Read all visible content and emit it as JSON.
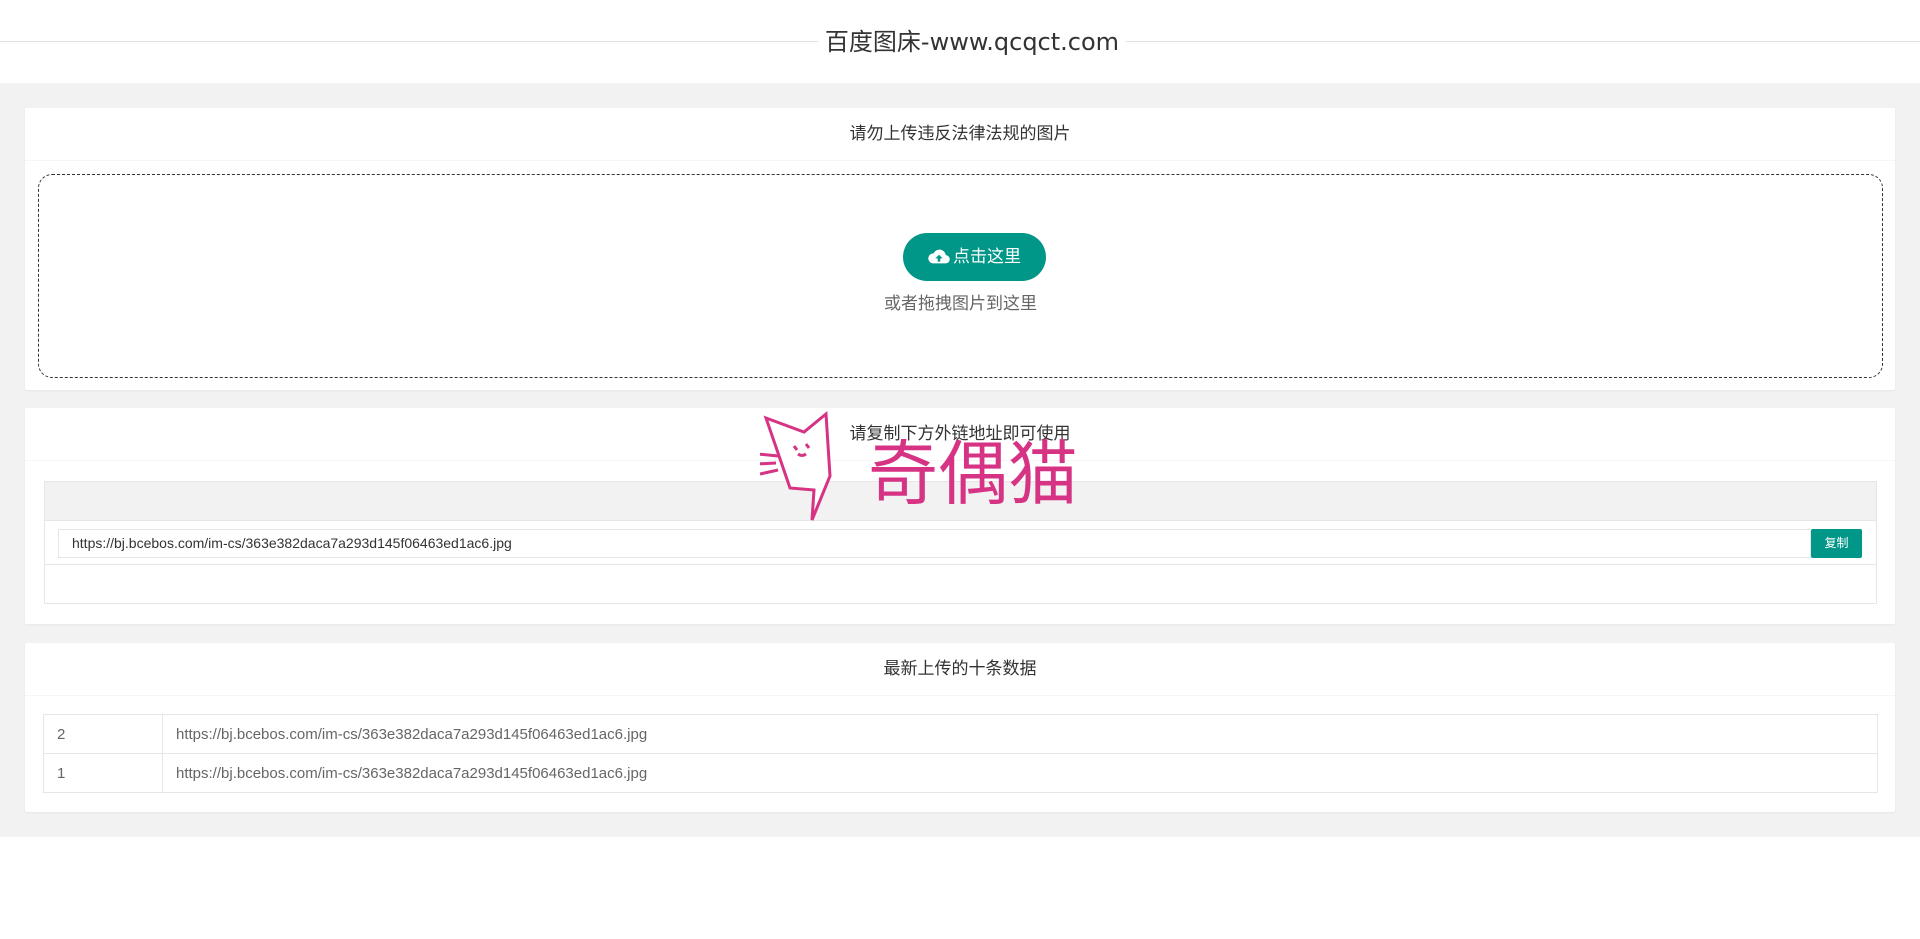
{
  "header": {
    "title": "百度图床-www.qcqct.com"
  },
  "upload_card": {
    "title": "请勿上传违反法律法规的图片",
    "button_label": "点击这里",
    "button_icon": "cloud-upload-icon",
    "drop_hint": "或者拖拽图片到这里"
  },
  "link_card": {
    "title": "请复制下方外链地址即可使用",
    "link_value": "https://bj.bcebos.com/im-cs/363e382daca7a293d145f06463ed1ac6.jpg",
    "copy_label": "复制"
  },
  "recent_card": {
    "title": "最新上传的十条数据",
    "rows": [
      {
        "id": "2",
        "url": "https://bj.bcebos.com/im-cs/363e382daca7a293d145f06463ed1ac6.jpg"
      },
      {
        "id": "1",
        "url": "https://bj.bcebos.com/im-cs/363e382daca7a293d145f06463ed1ac6.jpg"
      }
    ]
  },
  "watermark": {
    "text": "奇偶猫",
    "color": "#d63384"
  },
  "colors": {
    "accent": "#009688",
    "page_bg": "#f2f2f2"
  }
}
